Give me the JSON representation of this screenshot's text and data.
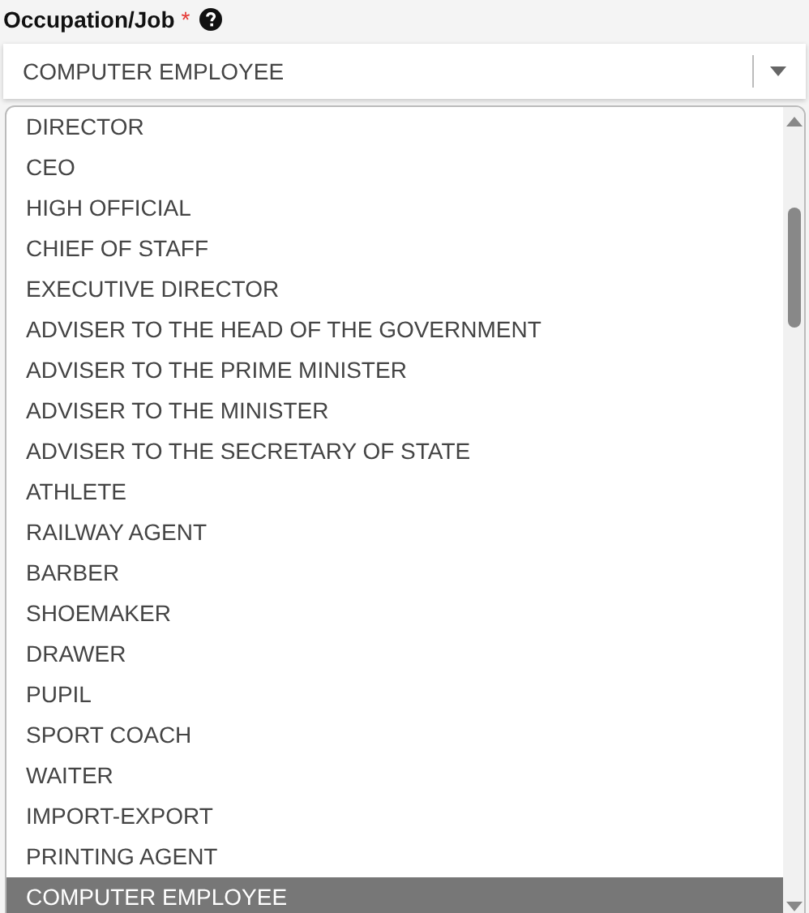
{
  "field": {
    "label": "Occupation/Job",
    "required_mark": "*",
    "value": "COMPUTER EMPLOYEE"
  },
  "options": [
    {
      "label": "DIRECTOR",
      "selected": false
    },
    {
      "label": "CEO",
      "selected": false
    },
    {
      "label": "HIGH OFFICIAL",
      "selected": false
    },
    {
      "label": "CHIEF OF STAFF",
      "selected": false
    },
    {
      "label": "EXECUTIVE DIRECTOR",
      "selected": false
    },
    {
      "label": "ADVISER TO THE HEAD OF THE GOVERNMENT",
      "selected": false
    },
    {
      "label": "ADVISER TO THE PRIME MINISTER",
      "selected": false
    },
    {
      "label": "ADVISER TO THE MINISTER",
      "selected": false
    },
    {
      "label": "ADVISER TO THE SECRETARY OF STATE",
      "selected": false
    },
    {
      "label": "ATHLETE",
      "selected": false
    },
    {
      "label": "RAILWAY AGENT",
      "selected": false
    },
    {
      "label": "BARBER",
      "selected": false
    },
    {
      "label": "SHOEMAKER",
      "selected": false
    },
    {
      "label": "DRAWER",
      "selected": false
    },
    {
      "label": "PUPIL",
      "selected": false
    },
    {
      "label": "SPORT COACH",
      "selected": false
    },
    {
      "label": "WAITER",
      "selected": false
    },
    {
      "label": "IMPORT-EXPORT",
      "selected": false
    },
    {
      "label": "PRINTING AGENT",
      "selected": false
    },
    {
      "label": "COMPUTER EMPLOYEE",
      "selected": true
    }
  ]
}
